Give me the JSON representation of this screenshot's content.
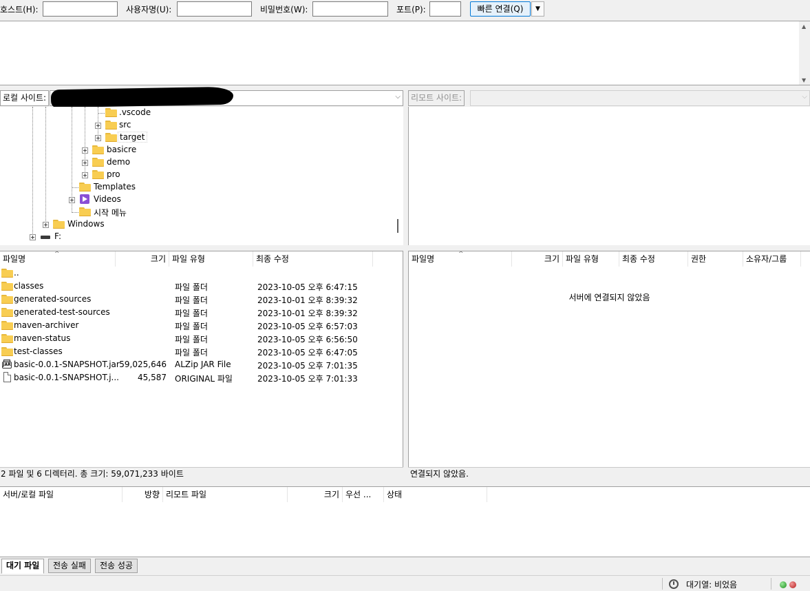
{
  "quickconnect": {
    "host_label": "호스트(H):",
    "host_value": "",
    "user_label": "사용자명(U):",
    "user_value": "",
    "pass_label": "비밀번호(W):",
    "pass_value": "",
    "port_label": "포트(P):",
    "port_value": "",
    "connect_label": "빠른 연결(Q)"
  },
  "local_site": {
    "label": "로컬 사이트:",
    "path_redacted": true
  },
  "remote_site": {
    "label": "리모트 사이트:"
  },
  "local_tree": [
    {
      "label": ".vscode",
      "icon": "folder-icon",
      "expandable": false
    },
    {
      "label": "src",
      "icon": "folder-icon",
      "expandable": true
    },
    {
      "label": "target",
      "icon": "folder-icon",
      "expandable": true,
      "selected": true
    },
    {
      "label": "basicre",
      "icon": "folder-icon",
      "expandable": true
    },
    {
      "label": "demo",
      "icon": "folder-icon",
      "expandable": true
    },
    {
      "label": "pro",
      "icon": "folder-icon",
      "expandable": true
    },
    {
      "label": "Templates",
      "icon": "folder-icon",
      "expandable": false
    },
    {
      "label": "Videos",
      "icon": "video-icon",
      "expandable": true
    },
    {
      "label": "시작 메뉴",
      "icon": "folder-icon",
      "expandable": false
    },
    {
      "label": "Windows",
      "icon": "folder-icon",
      "expandable": true
    },
    {
      "label": "F:",
      "icon": "drive-icon",
      "expandable": true
    }
  ],
  "local_list": {
    "columns": [
      "파일명",
      "크기",
      "파일 유형",
      "최종 수정"
    ],
    "rows": [
      {
        "name": "..",
        "size": "",
        "type": "",
        "modified": "",
        "icon": "folder-icon"
      },
      {
        "name": "classes",
        "size": "",
        "type": "파일 폴더",
        "modified": "2023-10-05 오후 6:47:15",
        "icon": "folder-icon"
      },
      {
        "name": "generated-sources",
        "size": "",
        "type": "파일 폴더",
        "modified": "2023-10-01 오후 8:39:32",
        "icon": "folder-icon"
      },
      {
        "name": "generated-test-sources",
        "size": "",
        "type": "파일 폴더",
        "modified": "2023-10-01 오후 8:39:32",
        "icon": "folder-icon"
      },
      {
        "name": "maven-archiver",
        "size": "",
        "type": "파일 폴더",
        "modified": "2023-10-05 오후 6:57:03",
        "icon": "folder-icon"
      },
      {
        "name": "maven-status",
        "size": "",
        "type": "파일 폴더",
        "modified": "2023-10-05 오후 6:56:50",
        "icon": "folder-icon"
      },
      {
        "name": "test-classes",
        "size": "",
        "type": "파일 폴더",
        "modified": "2023-10-05 오후 6:47:05",
        "icon": "folder-icon"
      },
      {
        "name": "basic-0.0.1-SNAPSHOT.jar",
        "size": "59,025,646",
        "type": "ALZip JAR File",
        "modified": "2023-10-05 오후 7:01:35",
        "icon": "jar-icon"
      },
      {
        "name": "basic-0.0.1-SNAPSHOT.j...",
        "size": "45,587",
        "type": "ORIGINAL 파일",
        "modified": "2023-10-05 오후 7:01:33",
        "icon": "file-icon"
      }
    ]
  },
  "remote_list": {
    "columns": [
      "파일명",
      "크기",
      "파일 유형",
      "최종 수정",
      "권한",
      "소유자/그룹"
    ],
    "empty_message": "서버에 연결되지 않았음"
  },
  "local_status": "2 파일 및 6 디렉터리. 총 크기: 59,071,233 바이트",
  "remote_status": "연결되지 않았음.",
  "queue": {
    "columns": [
      "서버/로컬 파일",
      "방향",
      "리모트 파일",
      "크기",
      "우선 ...",
      "상태"
    ]
  },
  "tabs": [
    "대기 파일",
    "전송 실패",
    "전송 성공"
  ],
  "statusbar": {
    "queue_text": "대기열: 비었음"
  }
}
